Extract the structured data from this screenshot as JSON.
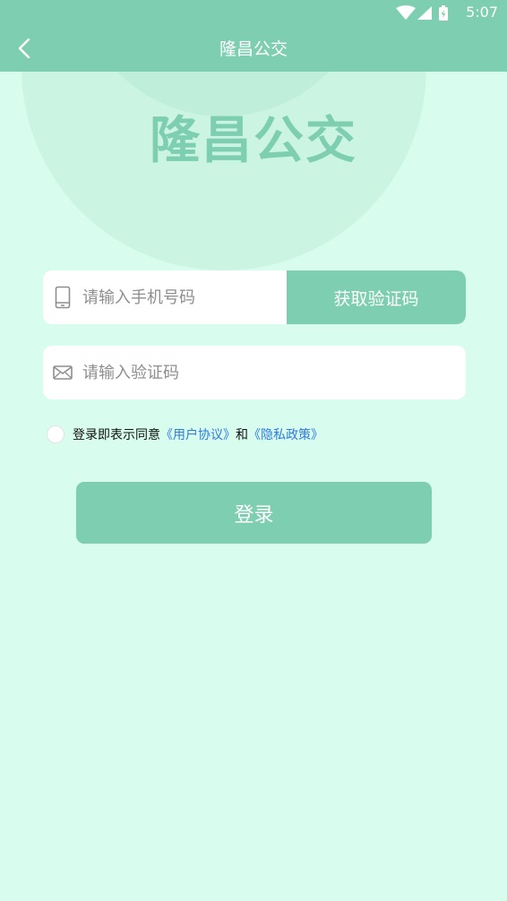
{
  "status_bar": {
    "time": "5:07"
  },
  "nav": {
    "title": "隆昌公交"
  },
  "brand": {
    "title": "隆昌公交"
  },
  "phone_field": {
    "placeholder": "请输入手机号码",
    "value": ""
  },
  "get_code_button": {
    "label": "获取验证码"
  },
  "code_field": {
    "placeholder": "请输入验证码",
    "value": ""
  },
  "agreement": {
    "prefix": "登录即表示同意",
    "user_agreement": "《用户协议》",
    "and": "和",
    "privacy_policy": "《隐私政策》"
  },
  "login_button": {
    "label": "登录"
  },
  "icons": {
    "back": "chevron-left-icon",
    "wifi": "wifi-icon",
    "signal": "signal-icon",
    "battery": "battery-icon",
    "phone": "phone-icon",
    "mail": "mail-icon"
  },
  "colors": {
    "primary": "#7ecfb2",
    "background": "#d8fced",
    "link": "#2e7be0"
  }
}
